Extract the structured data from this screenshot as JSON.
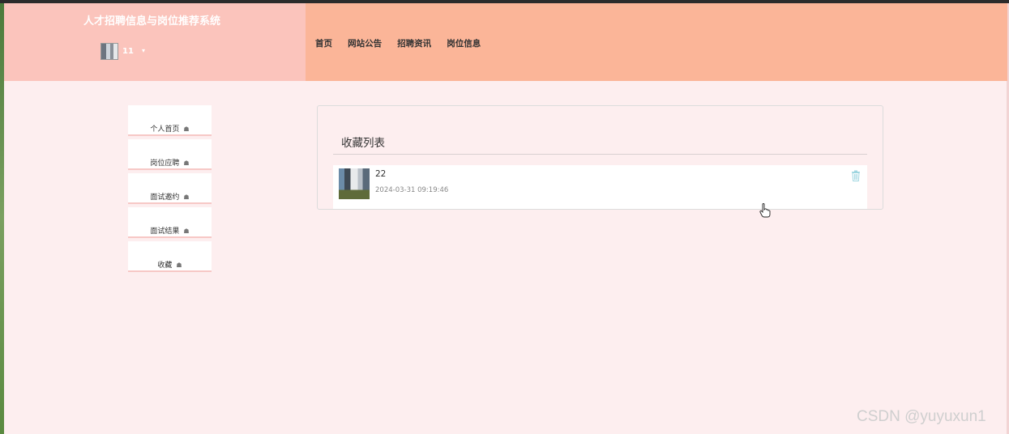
{
  "header": {
    "site_title": "人才招聘信息与岗位推荐系统",
    "user_name": "11",
    "caret": "▾",
    "nav": [
      "首页",
      "网站公告",
      "招聘资讯",
      "岗位信息"
    ]
  },
  "sidebar": {
    "items": [
      {
        "label": "个人首页",
        "icon": "hand-icon"
      },
      {
        "label": "岗位应聘",
        "icon": "hand-icon"
      },
      {
        "label": "面试邀约",
        "icon": "hand-icon"
      },
      {
        "label": "面试结果",
        "icon": "hand-icon"
      },
      {
        "label": "收藏",
        "icon": "hand-icon"
      }
    ]
  },
  "main": {
    "title": "收藏列表",
    "favorites": [
      {
        "name": "22",
        "time": "2024-03-31 09:19:46"
      }
    ]
  },
  "watermark": "CSDN @yuyuxun1",
  "colors": {
    "header_left": "#fbc4bc",
    "header_right": "#fbb598",
    "page_bg": "#fdeeef",
    "trash": "#9fd6e0"
  }
}
